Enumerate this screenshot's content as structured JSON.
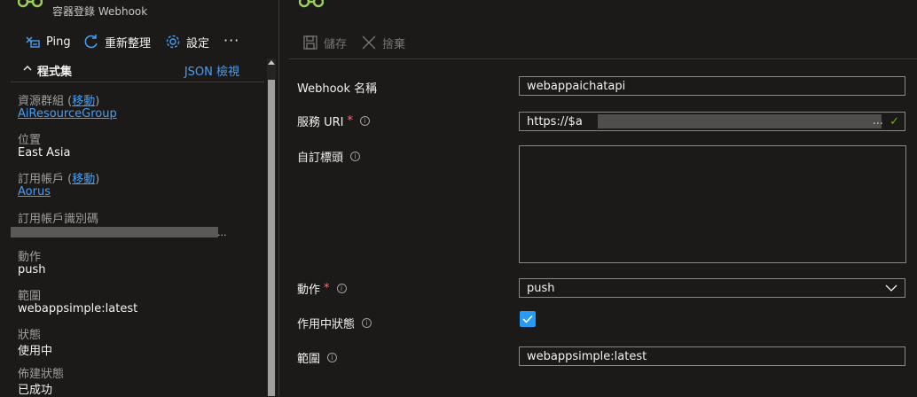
{
  "header": {
    "subtitle": "容器登錄 Webhook"
  },
  "toolbar": {
    "ping": "Ping",
    "refresh": "重新整理",
    "settings": "設定",
    "more": "···"
  },
  "essentials": {
    "title": "程式集",
    "json_view": "JSON 檢視",
    "resource_group_label": "資源群組 (",
    "move_link": "移動",
    "close_paren": ")",
    "resource_group_value": "AiResourceGroup",
    "location_label": "位置",
    "location_value": "East Asia",
    "subscription_label": "訂用帳戶 (",
    "subscription_value": "Aorus",
    "subscription_id_label": "訂用帳戶識別碼",
    "redacted_suffix": "...",
    "action_label": "動作",
    "action_value": "push",
    "scope_label": "範圍",
    "scope_value": "webappsimple:latest",
    "status_label": "狀態",
    "status_value": "使用中",
    "provisioning_label": "佈建狀態",
    "provisioning_value": "已成功"
  },
  "form_toolbar": {
    "save": "儲存",
    "discard": "捨棄"
  },
  "form": {
    "name_label": "Webhook 名稱",
    "name_value": "webappaichatapi",
    "uri_label": "服務 URI",
    "uri_value": "https://$a",
    "uri_suffix": "...",
    "headers_label": "自訂標頭",
    "action_label": "動作",
    "action_value": "push",
    "status_label": "作用中狀態",
    "scope_label": "範圍",
    "scope_value": "webappsimple:latest",
    "required_mark": "*",
    "info_glyph": "i",
    "check_glyph": "✓"
  },
  "colors": {
    "accent": "#479ef5",
    "checkbox": "#2899f5",
    "valid": "#6bb700",
    "required": "#f1707b"
  }
}
